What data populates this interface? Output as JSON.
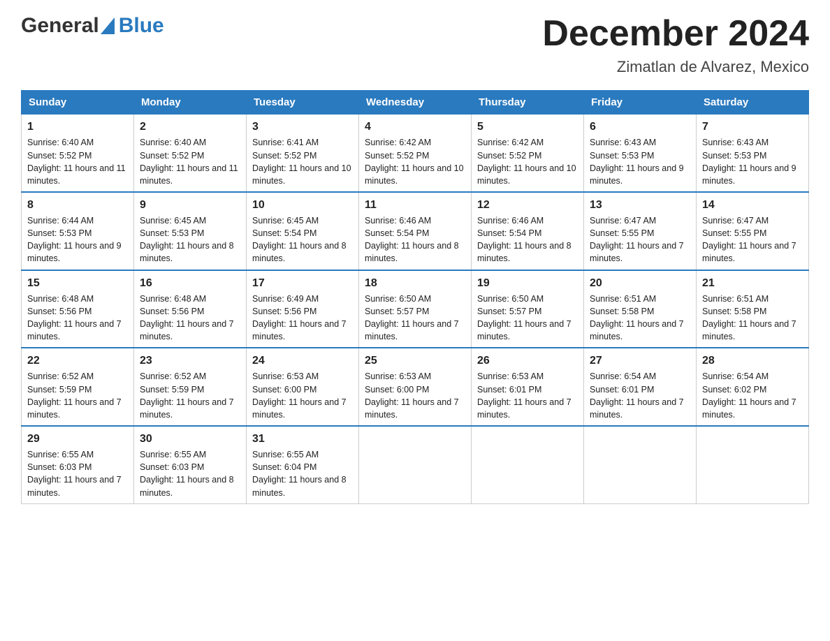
{
  "header": {
    "logo_general": "General",
    "logo_blue": "Blue",
    "title": "December 2024",
    "subtitle": "Zimatlan de Alvarez, Mexico"
  },
  "days_of_week": [
    "Sunday",
    "Monday",
    "Tuesday",
    "Wednesday",
    "Thursday",
    "Friday",
    "Saturday"
  ],
  "weeks": [
    [
      {
        "day": "1",
        "sunrise": "6:40 AM",
        "sunset": "5:52 PM",
        "daylight": "11 hours and 11 minutes."
      },
      {
        "day": "2",
        "sunrise": "6:40 AM",
        "sunset": "5:52 PM",
        "daylight": "11 hours and 11 minutes."
      },
      {
        "day": "3",
        "sunrise": "6:41 AM",
        "sunset": "5:52 PM",
        "daylight": "11 hours and 10 minutes."
      },
      {
        "day": "4",
        "sunrise": "6:42 AM",
        "sunset": "5:52 PM",
        "daylight": "11 hours and 10 minutes."
      },
      {
        "day": "5",
        "sunrise": "6:42 AM",
        "sunset": "5:52 PM",
        "daylight": "11 hours and 10 minutes."
      },
      {
        "day": "6",
        "sunrise": "6:43 AM",
        "sunset": "5:53 PM",
        "daylight": "11 hours and 9 minutes."
      },
      {
        "day": "7",
        "sunrise": "6:43 AM",
        "sunset": "5:53 PM",
        "daylight": "11 hours and 9 minutes."
      }
    ],
    [
      {
        "day": "8",
        "sunrise": "6:44 AM",
        "sunset": "5:53 PM",
        "daylight": "11 hours and 9 minutes."
      },
      {
        "day": "9",
        "sunrise": "6:45 AM",
        "sunset": "5:53 PM",
        "daylight": "11 hours and 8 minutes."
      },
      {
        "day": "10",
        "sunrise": "6:45 AM",
        "sunset": "5:54 PM",
        "daylight": "11 hours and 8 minutes."
      },
      {
        "day": "11",
        "sunrise": "6:46 AM",
        "sunset": "5:54 PM",
        "daylight": "11 hours and 8 minutes."
      },
      {
        "day": "12",
        "sunrise": "6:46 AM",
        "sunset": "5:54 PM",
        "daylight": "11 hours and 8 minutes."
      },
      {
        "day": "13",
        "sunrise": "6:47 AM",
        "sunset": "5:55 PM",
        "daylight": "11 hours and 7 minutes."
      },
      {
        "day": "14",
        "sunrise": "6:47 AM",
        "sunset": "5:55 PM",
        "daylight": "11 hours and 7 minutes."
      }
    ],
    [
      {
        "day": "15",
        "sunrise": "6:48 AM",
        "sunset": "5:56 PM",
        "daylight": "11 hours and 7 minutes."
      },
      {
        "day": "16",
        "sunrise": "6:48 AM",
        "sunset": "5:56 PM",
        "daylight": "11 hours and 7 minutes."
      },
      {
        "day": "17",
        "sunrise": "6:49 AM",
        "sunset": "5:56 PM",
        "daylight": "11 hours and 7 minutes."
      },
      {
        "day": "18",
        "sunrise": "6:50 AM",
        "sunset": "5:57 PM",
        "daylight": "11 hours and 7 minutes."
      },
      {
        "day": "19",
        "sunrise": "6:50 AM",
        "sunset": "5:57 PM",
        "daylight": "11 hours and 7 minutes."
      },
      {
        "day": "20",
        "sunrise": "6:51 AM",
        "sunset": "5:58 PM",
        "daylight": "11 hours and 7 minutes."
      },
      {
        "day": "21",
        "sunrise": "6:51 AM",
        "sunset": "5:58 PM",
        "daylight": "11 hours and 7 minutes."
      }
    ],
    [
      {
        "day": "22",
        "sunrise": "6:52 AM",
        "sunset": "5:59 PM",
        "daylight": "11 hours and 7 minutes."
      },
      {
        "day": "23",
        "sunrise": "6:52 AM",
        "sunset": "5:59 PM",
        "daylight": "11 hours and 7 minutes."
      },
      {
        "day": "24",
        "sunrise": "6:53 AM",
        "sunset": "6:00 PM",
        "daylight": "11 hours and 7 minutes."
      },
      {
        "day": "25",
        "sunrise": "6:53 AM",
        "sunset": "6:00 PM",
        "daylight": "11 hours and 7 minutes."
      },
      {
        "day": "26",
        "sunrise": "6:53 AM",
        "sunset": "6:01 PM",
        "daylight": "11 hours and 7 minutes."
      },
      {
        "day": "27",
        "sunrise": "6:54 AM",
        "sunset": "6:01 PM",
        "daylight": "11 hours and 7 minutes."
      },
      {
        "day": "28",
        "sunrise": "6:54 AM",
        "sunset": "6:02 PM",
        "daylight": "11 hours and 7 minutes."
      }
    ],
    [
      {
        "day": "29",
        "sunrise": "6:55 AM",
        "sunset": "6:03 PM",
        "daylight": "11 hours and 7 minutes."
      },
      {
        "day": "30",
        "sunrise": "6:55 AM",
        "sunset": "6:03 PM",
        "daylight": "11 hours and 8 minutes."
      },
      {
        "day": "31",
        "sunrise": "6:55 AM",
        "sunset": "6:04 PM",
        "daylight": "11 hours and 8 minutes."
      },
      null,
      null,
      null,
      null
    ]
  ]
}
